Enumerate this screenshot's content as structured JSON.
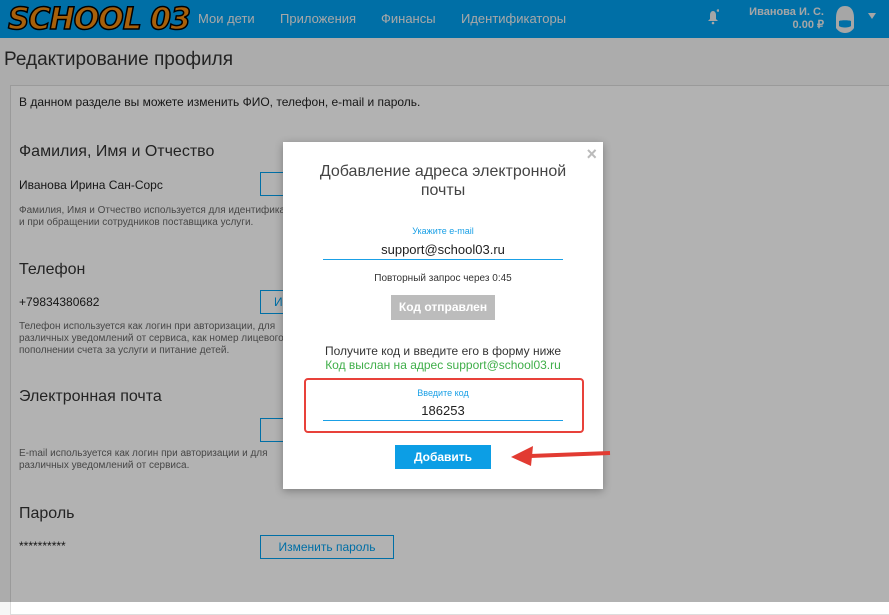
{
  "header": {
    "logo": "SCHOOL 03",
    "nav": [
      "Мои дети",
      "Приложения",
      "Финансы",
      "Идентификаторы"
    ],
    "user_name": "Иванова И. С.",
    "balance": "0.00 ₽",
    "accent": "#009fee"
  },
  "page": {
    "title": "Редактирование профиля",
    "intro": "В данном разделе вы можете изменить ФИО, телефон, e-mail и пароль.",
    "fio": {
      "title": "Фамилия, Имя и Отчество",
      "value": "Иванова Ирина Сан-Сорс",
      "desc1": "Фамилия, Имя и Отчество используется для идентификации",
      "desc2": "и при обращении сотрудников поставщика услуги."
    },
    "phone": {
      "title": "Телефон",
      "value": "+79834380682",
      "button": "Изменить телефон",
      "desc1": "Телефон используется как логин при авторизации, для",
      "desc2": "различных уведомлений от сервиса, как номер лицевого",
      "desc3": "пополнении счета за услуги и питание детей."
    },
    "email": {
      "title": "Электронная почта",
      "desc1": "E-mail используется как логин при авторизации и для",
      "desc2": "различных уведомлений от сервиса."
    },
    "password": {
      "title": "Пароль",
      "value": "**********",
      "button": "Изменить пароль"
    }
  },
  "modal": {
    "title": "Добавление адреса электронной почты",
    "email_label": "Укажите e-mail",
    "email_value": "support@school03.ru",
    "retry": "Повторный запрос через 0:45",
    "sent_button": "Код отправлен",
    "hint": "Получите код и введите его в форму ниже",
    "sent_to": "Код выслан на адрес support@school03.ru",
    "code_label": "Введите код",
    "code_value": "186253",
    "add_button": "Добавить",
    "close": "×"
  }
}
